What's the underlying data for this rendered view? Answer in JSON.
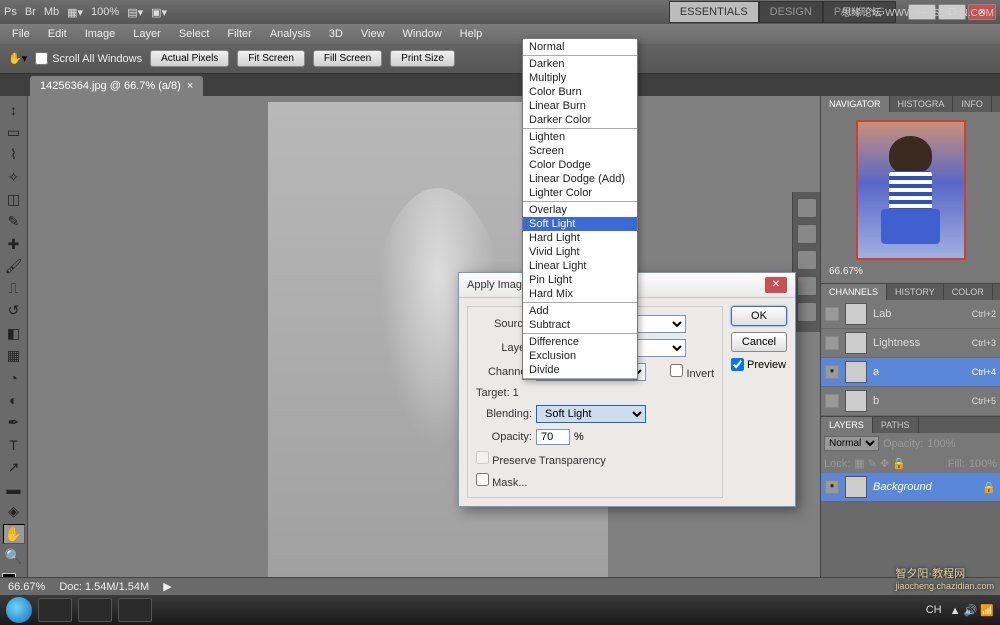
{
  "titlebar": {
    "workspaces": [
      "ESSENTIALS",
      "DESIGN",
      "PAINTING"
    ],
    "active_workspace": "ESSENTIALS",
    "zoom_toolbar": "100%",
    "watermark": "思缘论坛·WWW.MISSYUAN.COM"
  },
  "menu": [
    "File",
    "Edit",
    "Image",
    "Layer",
    "Select",
    "Filter",
    "Analysis",
    "3D",
    "View",
    "Window",
    "Help"
  ],
  "options": {
    "scroll_all": "Scroll All Windows",
    "buttons": [
      "Actual Pixels",
      "Fit Screen",
      "Fill Screen",
      "Print Size"
    ]
  },
  "document": {
    "tab": "14256364.jpg @ 66.7% (a/8)"
  },
  "blend_modes": {
    "groups": [
      [
        "Normal"
      ],
      [
        "Darken",
        "Multiply",
        "Color Burn",
        "Linear Burn",
        "Darker Color"
      ],
      [
        "Lighten",
        "Screen",
        "Color Dodge",
        "Linear Dodge (Add)",
        "Lighter Color"
      ],
      [
        "Overlay",
        "Soft Light",
        "Hard Light",
        "Vivid Light",
        "Linear Light",
        "Pin Light",
        "Hard Mix"
      ],
      [
        "Add",
        "Subtract"
      ],
      [
        "Difference",
        "Exclusion",
        "Divide"
      ]
    ],
    "selected": "Soft Light"
  },
  "dialog": {
    "title": "Apply Image",
    "labels": {
      "source": "Source:",
      "layer": "Layer:",
      "channel": "Channel:",
      "target": "Target: 1",
      "blending": "Blending:",
      "opacity": "Opacity:",
      "percent": "%",
      "preserve": "Preserve Transparency",
      "mask": "Mask...",
      "invert": "Invert"
    },
    "blending_value": "Soft Light",
    "opacity_value": "70",
    "buttons": {
      "ok": "OK",
      "cancel": "Cancel",
      "preview": "Preview"
    }
  },
  "navigator": {
    "tabs": [
      "NAVIGATOR",
      "HISTOGRA",
      "INFO"
    ],
    "zoom": "66.67%"
  },
  "channels": {
    "tabs": [
      "CHANNELS",
      "HISTORY",
      "COLOR"
    ],
    "rows": [
      {
        "name": "Lab",
        "short": "Ctrl+2",
        "eye": false
      },
      {
        "name": "Lightness",
        "short": "Ctrl+3",
        "eye": false
      },
      {
        "name": "a",
        "short": "Ctrl+4",
        "eye": true,
        "sel": true
      },
      {
        "name": "b",
        "short": "Ctrl+5",
        "eye": false
      }
    ]
  },
  "layers": {
    "tabs": [
      "LAYERS",
      "PATHS"
    ],
    "mode": "Normal",
    "opacity_label": "Opacity:",
    "opacity": "100%",
    "lock": "Lock:",
    "fill_label": "Fill:",
    "fill": "100%",
    "rows": [
      {
        "name": "Background",
        "locked": true
      }
    ]
  },
  "status": {
    "zoom": "66.67%",
    "doc": "Doc: 1.54M/1.54M"
  },
  "taskbar": {
    "lang": "CH",
    "watermark": "智夕阳·教程网",
    "sub": "jiaocheng.chazidian.com"
  }
}
